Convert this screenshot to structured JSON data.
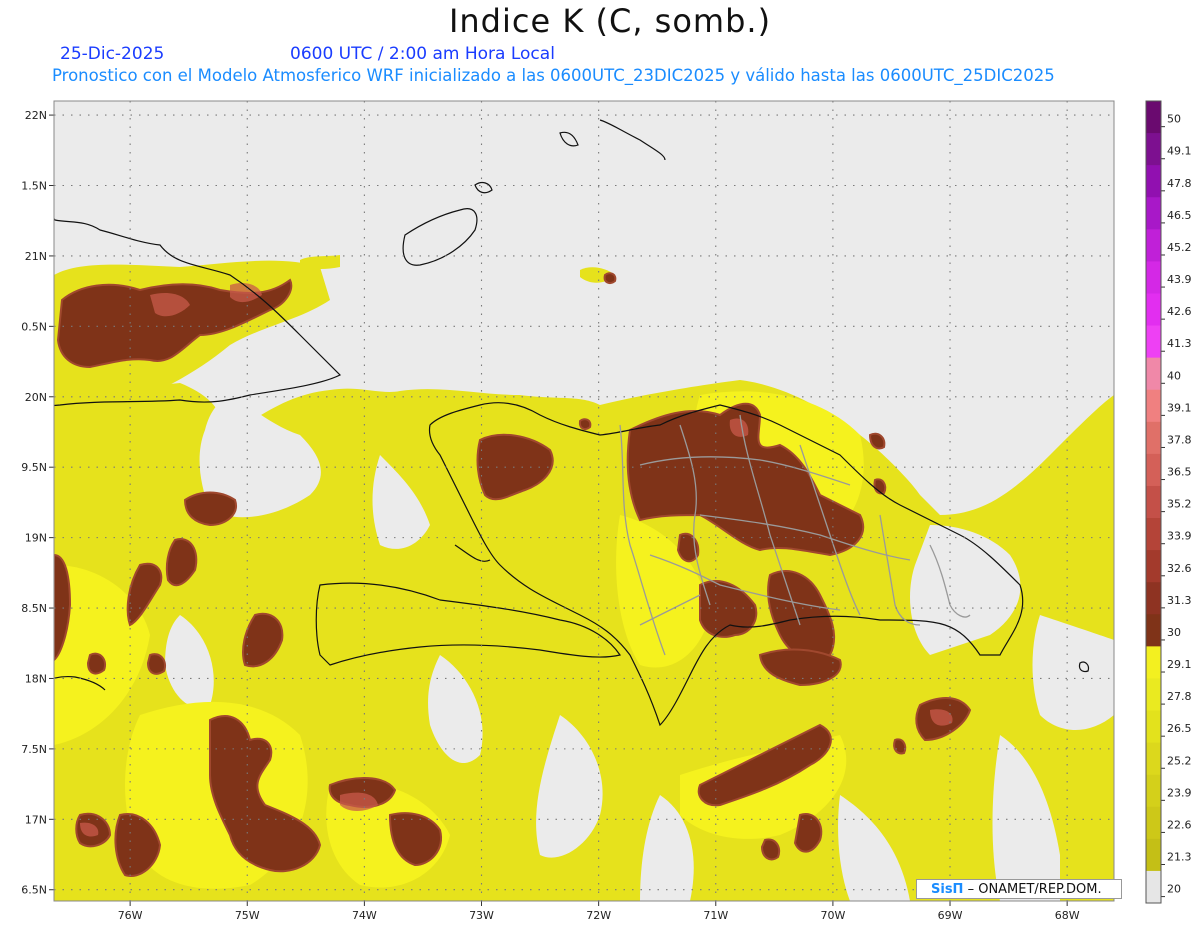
{
  "header": {
    "title": "Indice K (C, somb.)",
    "date": "25-Dic-2025",
    "time": "0600 UTC / 2:00 am Hora Local",
    "subtitle": "Pronostico con el Modelo Atmosferico WRF inicializado a las 0600UTC_23DIC2025 y válido hasta las  0600UTC_25DIC2025"
  },
  "map": {
    "lon_range": [
      -76.65,
      -67.6
    ],
    "lat_range": [
      16.42,
      22.1
    ],
    "lat_labels": [
      "22N",
      "1.5N",
      "21N",
      "0.5N",
      "20N",
      "9.5N",
      "19N",
      "8.5N",
      "18N",
      "7.5N",
      "17N",
      "6.5N"
    ],
    "lat_values": [
      22,
      21.5,
      21,
      20.5,
      20,
      19.5,
      19,
      18.5,
      18,
      17.5,
      17,
      16.5
    ],
    "lon_labels": [
      "76W",
      "75W",
      "74W",
      "73W",
      "72W",
      "71W",
      "70W",
      "69W",
      "68W"
    ],
    "lon_values": [
      -76,
      -75,
      -74,
      -73,
      -72,
      -71,
      -70,
      -69,
      -68
    ],
    "colors": {
      "background": "#ebebeb",
      "coast": "#111111",
      "provinces": "#9a9a9a",
      "grid": "#7a7a7a"
    }
  },
  "colorbar": {
    "labels": [
      "50",
      "49.1",
      "47.8",
      "46.5",
      "45.2",
      "43.9",
      "42.6",
      "41.3",
      "40",
      "39.1",
      "37.8",
      "36.5",
      "35.2",
      "33.9",
      "32.6",
      "31.3",
      "30",
      "29.1",
      "27.8",
      "26.5",
      "25.2",
      "23.9",
      "22.6",
      "21.3",
      "20"
    ],
    "colors": [
      "#6a0a6f",
      "#7d1090",
      "#9110b0",
      "#a818c8",
      "#c020d8",
      "#d428e6",
      "#e22ef0",
      "#ee40f4",
      "#f088a8",
      "#f08080",
      "#e07068",
      "#d46058",
      "#c45048",
      "#b44438",
      "#a33a2c",
      "#8e3322",
      "#7f3318",
      "#f3f020",
      "#eaea20",
      "#e3e21c",
      "#dcd81c",
      "#d4d01a",
      "#cdc818",
      "#c4bf16",
      "#e6e6e6"
    ]
  },
  "credit": {
    "brand": "SisΠ",
    "org": "– ONAMET/REP.DOM."
  }
}
